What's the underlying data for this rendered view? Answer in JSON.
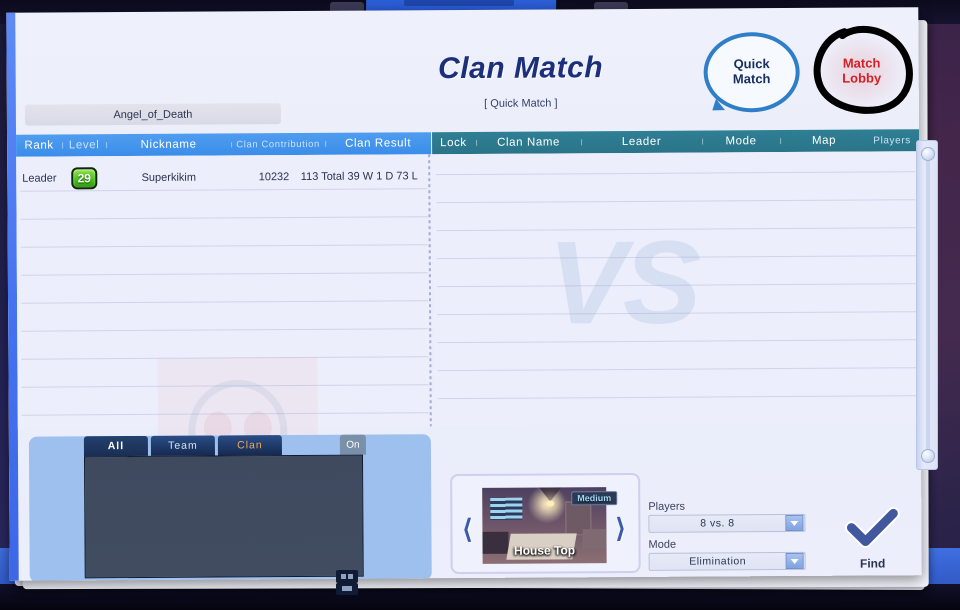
{
  "window": {
    "title": "Clan Match",
    "subtitle": "[ Quick Match ]"
  },
  "header": {
    "quick_match_bubble": "Quick\nMatch",
    "quick_match_line1": "Quick",
    "quick_match_line2": "Match",
    "match_lobby_line1": "Match",
    "match_lobby_line2": "Lobby",
    "annotation": "hand-drawn-circle-around-match-lobby"
  },
  "clan": {
    "name": "Angel_of_Death",
    "emblem": "skull-and-crossbones"
  },
  "members_table": {
    "columns": [
      "Rank",
      "Level",
      "Nickname",
      "Clan Contribution",
      "Clan Result"
    ],
    "rows": [
      {
        "rank": "Leader",
        "level": "29",
        "nickname": "Superkikim",
        "contribution": "10232",
        "result": "113 Total 39 W 1 D 73 L"
      }
    ]
  },
  "lobby_table": {
    "columns": [
      "Lock",
      "Clan Name",
      "Leader",
      "Mode",
      "Map",
      "Players"
    ],
    "rows": [],
    "watermark": "VS"
  },
  "chat": {
    "tabs": [
      {
        "label": "All",
        "active": true
      },
      {
        "label": "Team",
        "active": false
      },
      {
        "label": "Clan",
        "active": false
      }
    ],
    "toggle": "On",
    "messages": []
  },
  "map_picker": {
    "name": "House Top",
    "difficulty": "Medium",
    "prev_icon": "chevron-left-icon",
    "next_icon": "chevron-right-icon"
  },
  "settings": {
    "players_label": "Players",
    "players_value": "8 vs. 8",
    "mode_label": "Mode",
    "mode_value": "Elimination"
  },
  "find": {
    "label": "Find",
    "icon": "checkmark-icon"
  },
  "colors": {
    "accent_blue": "#3a8de9",
    "header_teal": "#2f7f95",
    "title_navy": "#1b2f7a",
    "lobby_red": "#d41f26",
    "level_green": "#49c31a",
    "clan_tab_orange": "#f0a955"
  }
}
